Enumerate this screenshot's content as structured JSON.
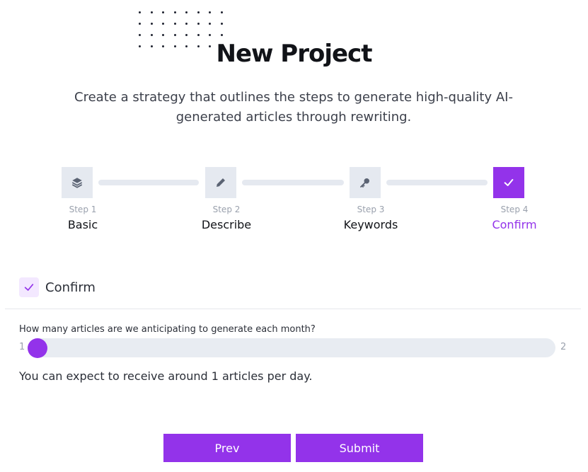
{
  "header": {
    "title": "New Project",
    "subtitle": "Create a strategy that outlines the steps to generate high-quality AI-generated articles through rewriting."
  },
  "steps": [
    {
      "number": "Step 1",
      "name": "Basic",
      "icon": "layers-icon",
      "active": false
    },
    {
      "number": "Step 2",
      "name": "Describe",
      "icon": "pencil-icon",
      "active": false
    },
    {
      "number": "Step 3",
      "name": "Keywords",
      "icon": "key-icon",
      "active": false
    },
    {
      "number": "Step 4",
      "name": "Confirm",
      "icon": "check-icon",
      "active": true
    }
  ],
  "confirm": {
    "label": "Confirm",
    "icon": "check-icon"
  },
  "articles": {
    "question": "How many articles are we anticipating to generate each month?",
    "min": "1",
    "max": "2",
    "value": 1,
    "expectation": "You can expect to receive around 1 articles per day."
  },
  "buttons": {
    "prev": "Prev",
    "submit": "Submit"
  },
  "colors": {
    "accent": "#9333ea",
    "inactive": "#e5e9f0",
    "muted": "#9aa1ad"
  }
}
